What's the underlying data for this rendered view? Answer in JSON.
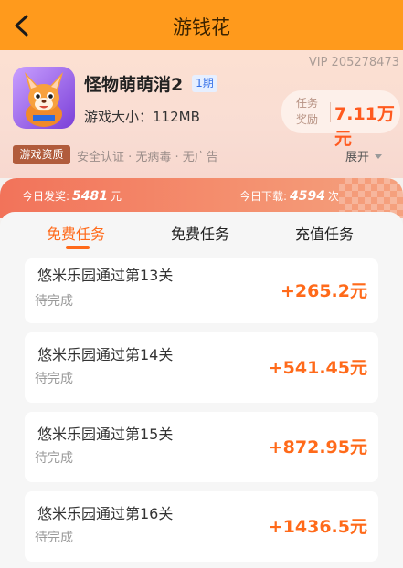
{
  "header": {
    "title": "游钱花",
    "back_icon": "chevron-left-icon"
  },
  "game": {
    "vip_text": "VIP 205278473",
    "title": "怪物萌萌消2",
    "phase": "1期",
    "size_text": "游戏大小：112MB",
    "reward_label": "任务奖励",
    "reward_amount": "7.11万元",
    "icon": "game-fox-icon"
  },
  "tags": {
    "chip": "游戏资质",
    "text": "安全认证 · 无病毒 · 无广告",
    "expand_label": "展开"
  },
  "stats": {
    "payout_label": "今日发奖:",
    "payout_value": "5481",
    "payout_unit": "元",
    "download_label": "今日下载:",
    "download_value": "4594",
    "download_unit": "次"
  },
  "tabs": [
    {
      "label": "免费任务",
      "active": true
    },
    {
      "label": "免费任务",
      "active": false
    },
    {
      "label": "充值任务",
      "active": false
    }
  ],
  "tasks": [
    {
      "title": "悠米乐园通过第13关",
      "status": "待完成",
      "reward": "+265.2元"
    },
    {
      "title": "悠米乐园通过第14关",
      "status": "待完成",
      "reward": "+541.45元"
    },
    {
      "title": "悠米乐园通过第15关",
      "status": "待完成",
      "reward": "+872.95元"
    },
    {
      "title": "悠米乐园通过第16关",
      "status": "待完成",
      "reward": "+1436.5元"
    }
  ],
  "colors": {
    "header": "#ff9a1c",
    "accent": "#ff6a1a",
    "stats_bar": "#f2735a",
    "chip": "#b15c3c"
  }
}
